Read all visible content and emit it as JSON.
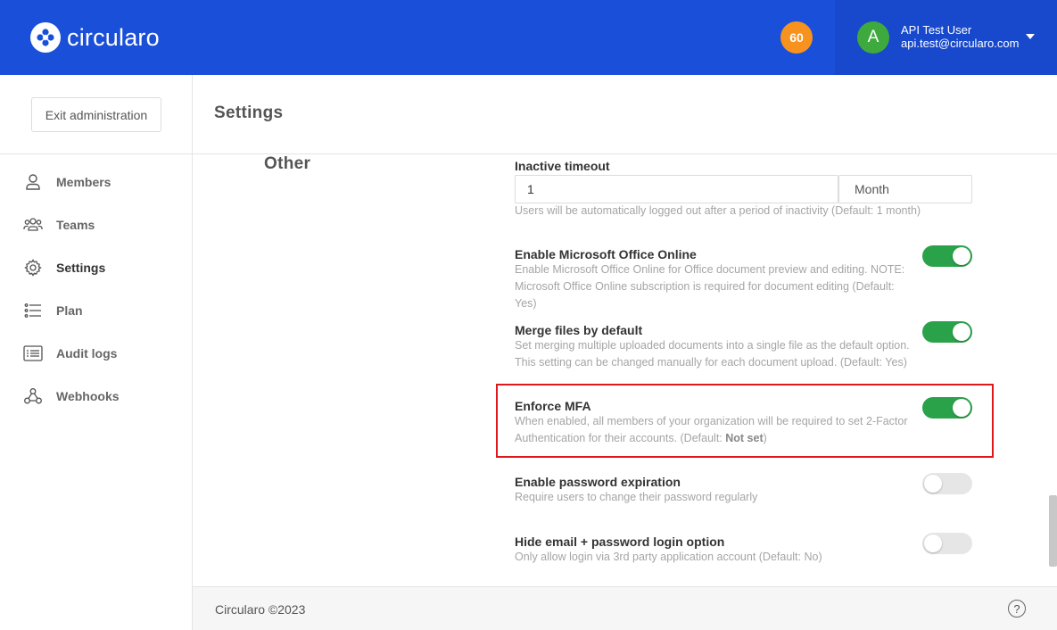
{
  "header": {
    "brand": "circularo",
    "notification_count": "60",
    "user": {
      "initial": "A",
      "name": "API Test User",
      "email": "api.test@circularo.com"
    }
  },
  "sidebar": {
    "exit_label": "Exit administration",
    "items": [
      {
        "label": "Members",
        "icon": "person-icon"
      },
      {
        "label": "Teams",
        "icon": "team-icon"
      },
      {
        "label": "Settings",
        "icon": "gear-icon",
        "active": true
      },
      {
        "label": "Plan",
        "icon": "list-icon"
      },
      {
        "label": "Audit logs",
        "icon": "log-icon"
      },
      {
        "label": "Webhooks",
        "icon": "webhook-icon"
      }
    ]
  },
  "page": {
    "title": "Settings",
    "section": "Other"
  },
  "settings": {
    "inactive_timeout": {
      "label": "Inactive timeout",
      "value": "1",
      "unit": "Month",
      "description": "Users will be automatically logged out after a period of inactivity  (Default: 1 month)"
    },
    "office_online": {
      "label": "Enable Microsoft Office Online",
      "description": "Enable Microsoft Office Online for Office document preview and editing. NOTE: Microsoft Office Online subscription is required for document editing  (Default: Yes)",
      "enabled": true
    },
    "merge_files": {
      "label": "Merge files by default",
      "description": "Set merging multiple uploaded documents into a single file as the default option. This setting can be changed manually for each document upload.  (Default: Yes)",
      "enabled": true
    },
    "enforce_mfa": {
      "label": "Enforce MFA",
      "description": "When enabled, all members of your organization will be required to set 2-Factor Authentication for their accounts.  (Default: ",
      "default_value": "Not set",
      "description_end": ")",
      "enabled": true
    },
    "password_expiration": {
      "label": "Enable password expiration",
      "description": "Require users to change their password regularly",
      "enabled": false
    },
    "hide_email_login": {
      "label": "Hide email + password login option",
      "description": "Only allow login via 3rd party application account  (Default: No)",
      "enabled": false
    }
  },
  "footer": {
    "copyright": "Circularo ©2023",
    "help": "?"
  },
  "colors": {
    "brand_blue": "#1a4fd9",
    "toggle_on": "#2aa24a",
    "badge_orange": "#f7921e",
    "avatar_green": "#3eaa3e",
    "highlight_red": "#e0181b"
  }
}
